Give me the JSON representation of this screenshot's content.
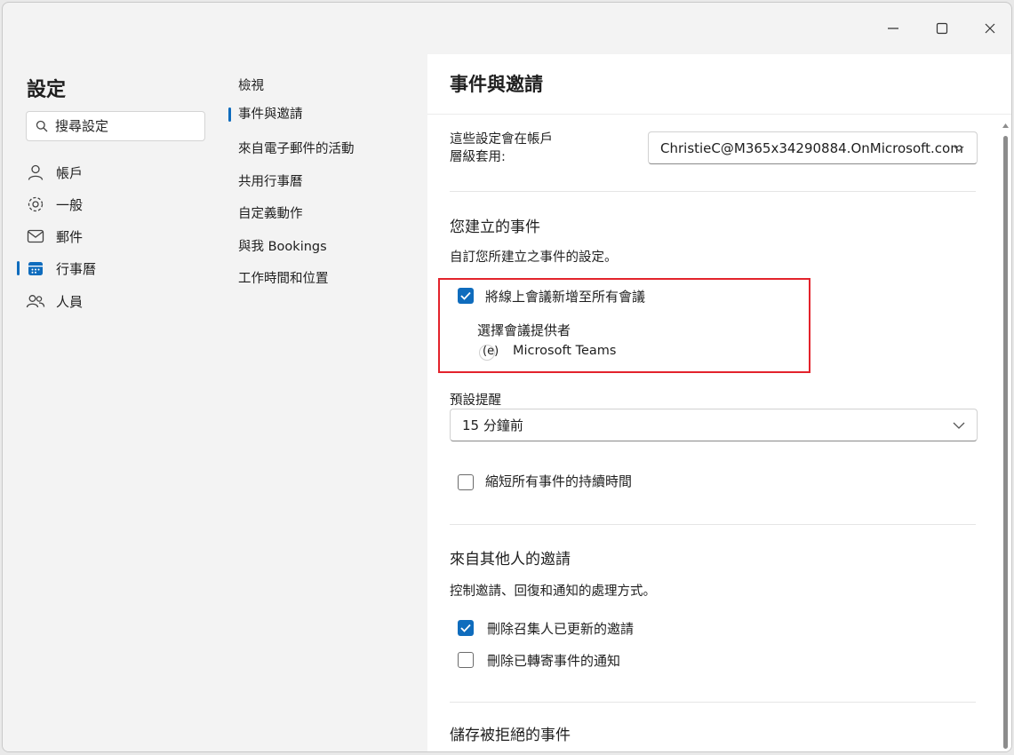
{
  "window": {
    "controls": [
      "minimize",
      "maximize",
      "close"
    ]
  },
  "settings": {
    "title": "設定",
    "search_placeholder": "搜尋設定"
  },
  "sidebar": {
    "items": [
      {
        "label": "帳戶",
        "icon": "person-icon",
        "active": false
      },
      {
        "label": "一般",
        "icon": "gear-icon",
        "active": false
      },
      {
        "label": "郵件",
        "icon": "mail-icon",
        "active": false
      },
      {
        "label": "行事曆",
        "icon": "calendar-icon",
        "active": true
      },
      {
        "label": "人員",
        "icon": "people-icon",
        "active": false
      }
    ]
  },
  "subnav": {
    "items": [
      {
        "label": "檢視",
        "active": false
      },
      {
        "label": "事件與邀請",
        "active": true
      },
      {
        "label": "來自電子郵件的活動",
        "active": false
      },
      {
        "label": "共用行事曆",
        "active": false
      },
      {
        "label": "自定義動作",
        "active": false
      },
      {
        "label": "與我 Bookings",
        "active": false
      },
      {
        "label": "工作時間和位置",
        "active": false
      }
    ]
  },
  "content": {
    "header": "事件與邀請",
    "account_label_line1": "這些設定會在帳戶",
    "account_label_line2": "層級套用:",
    "account_value": "ChristieC@M365x34290884.OnMicrosoft.com",
    "events_section": {
      "title": "您建立的事件",
      "description": "自訂您所建立之事件的設定。",
      "add_online_meeting": {
        "label": "將線上會議新增至所有會議",
        "checked": true
      },
      "provider_label": "選擇會議提供者",
      "provider_marker": "(e)",
      "provider_value": "Microsoft Teams",
      "reminder_label": "預設提醒",
      "reminder_value": "15 分鐘前",
      "shorten_events": {
        "label": "縮短所有事件的持續時間",
        "checked": false
      }
    },
    "invites_section": {
      "title": "來自其他人的邀請",
      "description": "控制邀請、回復和通知的處理方式。",
      "delete_updated": {
        "label": "刪除召集人已更新的邀請",
        "checked": true
      },
      "delete_forwarded": {
        "label": "刪除已轉寄事件的通知",
        "checked": false
      }
    },
    "declined_section": {
      "title": "儲存被拒絕的事件"
    }
  },
  "colors": {
    "accent": "#0f6cbd",
    "highlight": "#e3232c",
    "pane_bg": "#f3f3f3",
    "content_bg": "#ffffff"
  }
}
